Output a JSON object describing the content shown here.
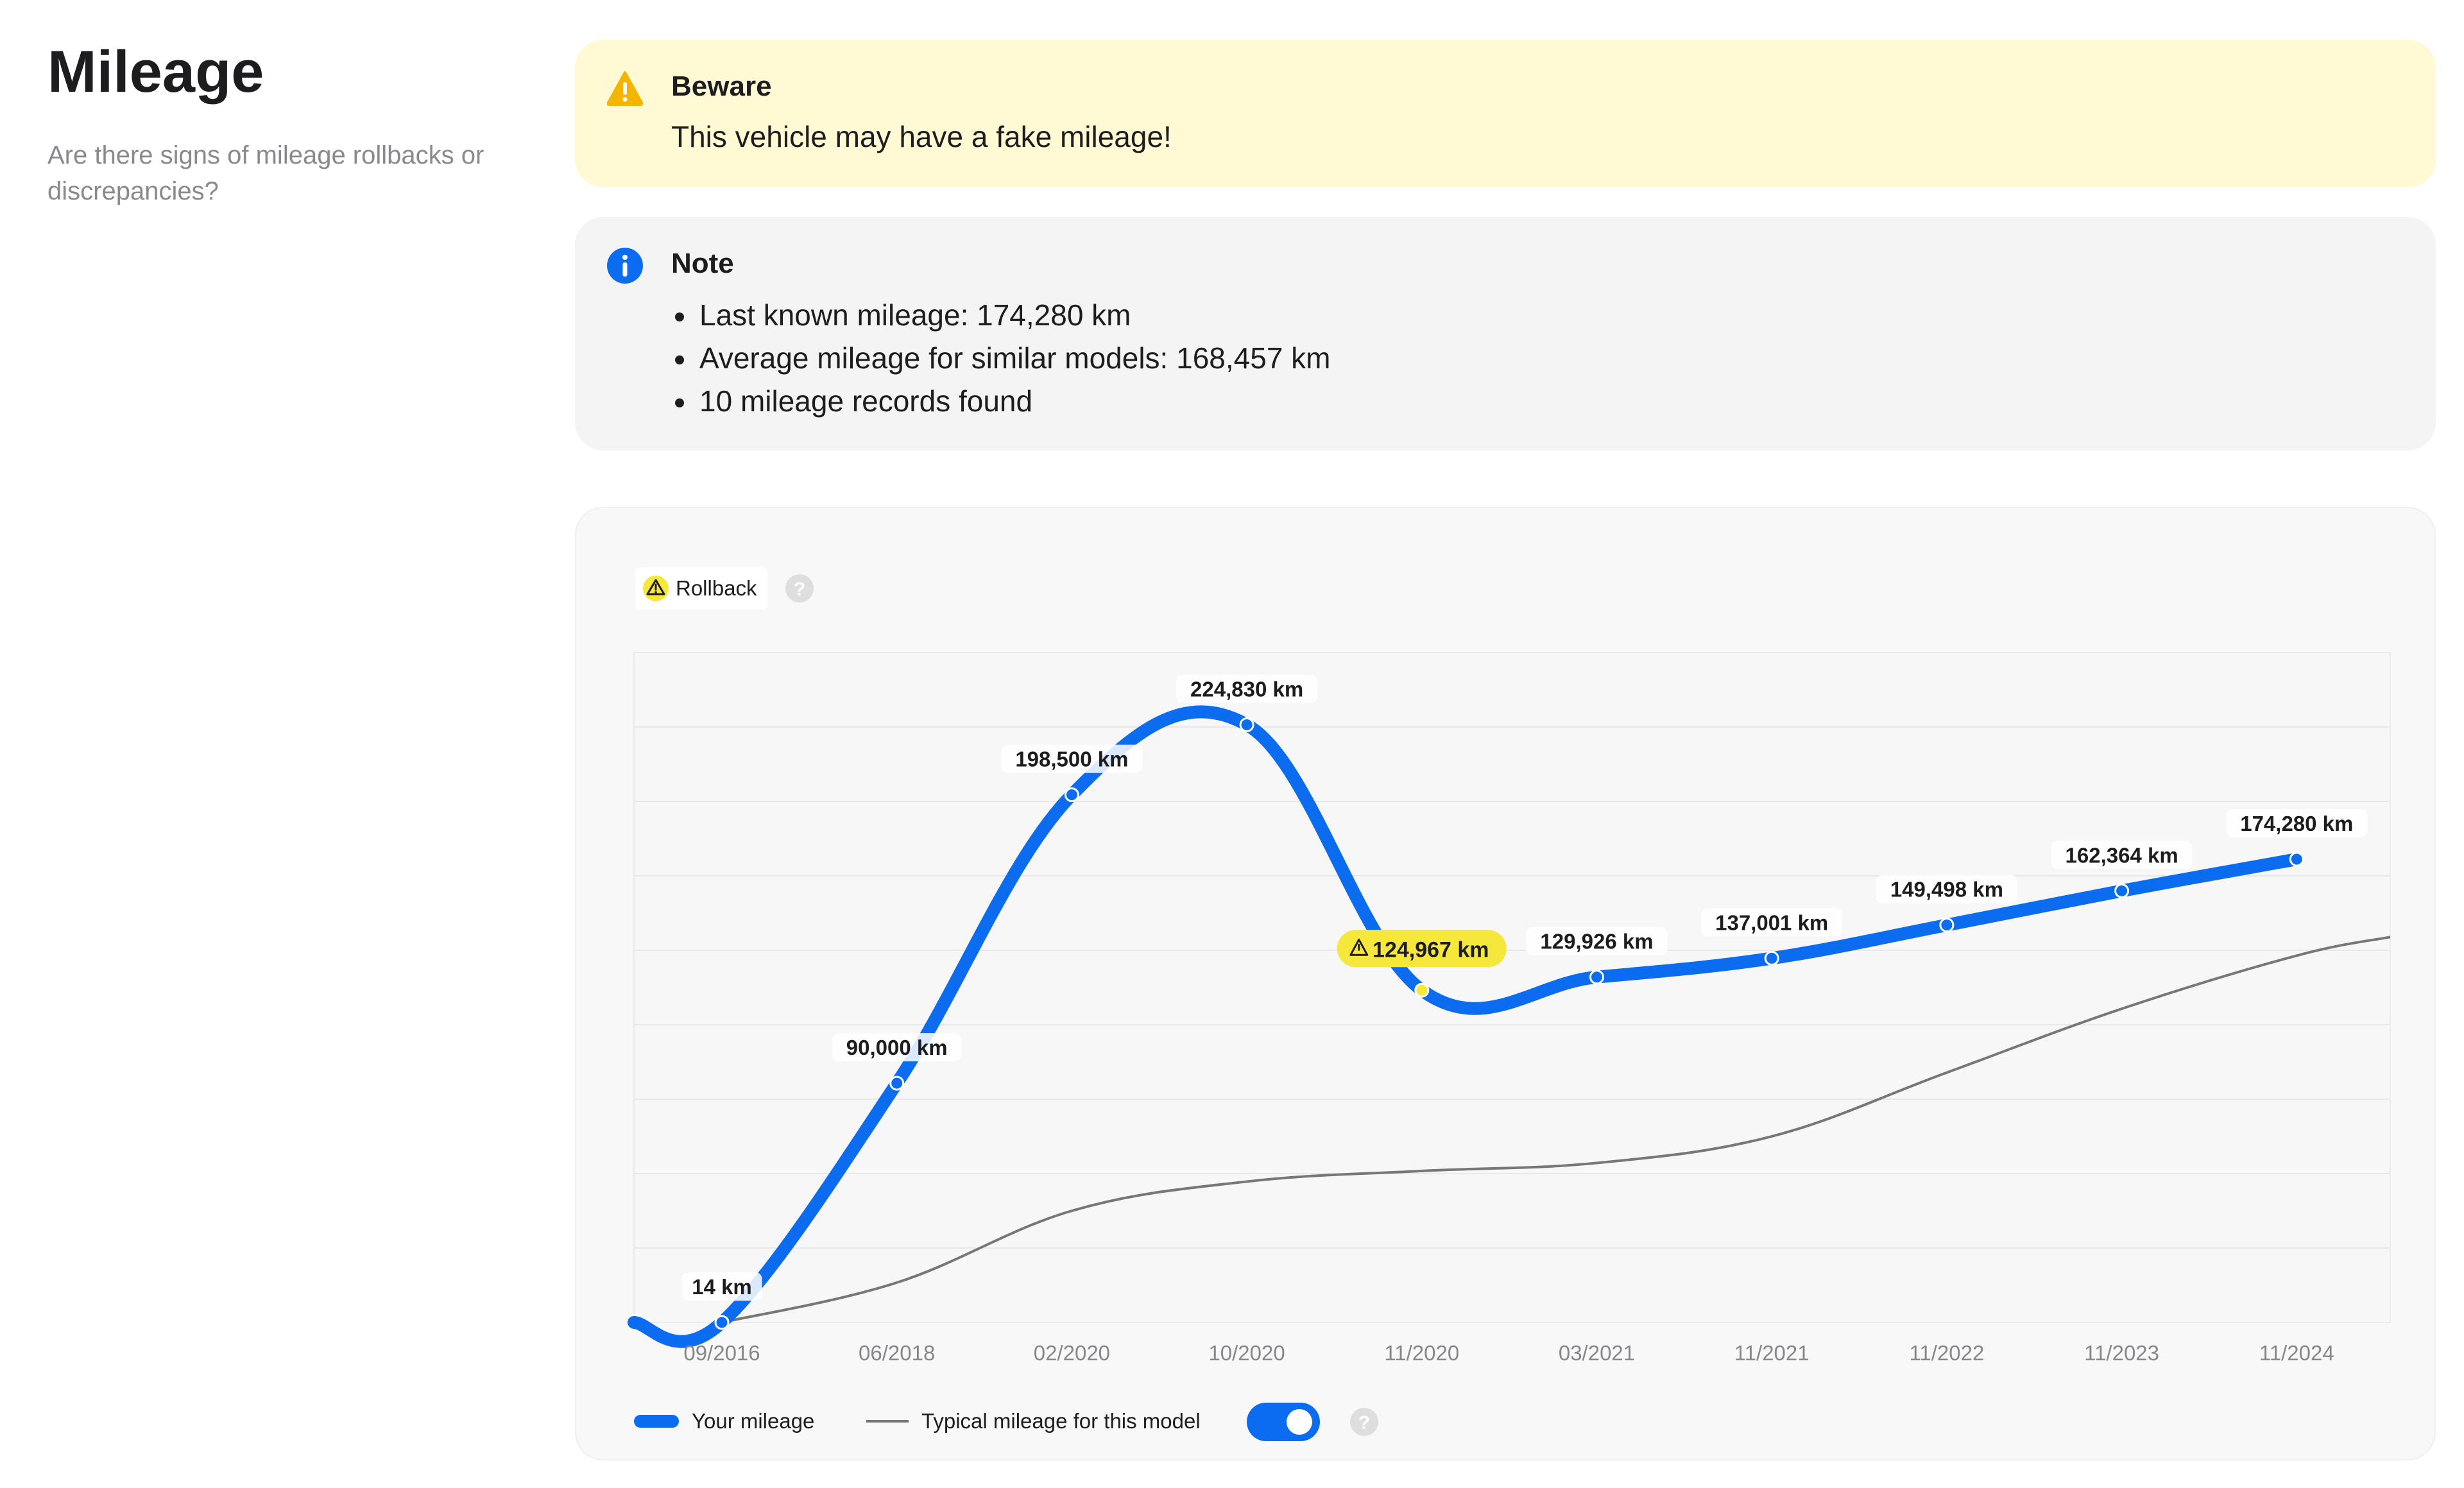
{
  "header": {
    "title": "Mileage",
    "subtitle": "Are there signs of mileage rollbacks or discrepancies?"
  },
  "warning": {
    "title": "Beware",
    "message": "This vehicle may have a fake mileage!",
    "icon": "warning-triangle-icon",
    "color": "#f5b400"
  },
  "note": {
    "title": "Note",
    "icon": "info-icon",
    "color": "#0b6cf0",
    "items": [
      "Last known mileage: 174,280 km",
      "Average mileage for similar models: 168,457 km",
      "10 mileage records found"
    ]
  },
  "chart_header": {
    "badge_label": "Rollback",
    "badge_icon": "warning-triangle-icon",
    "help_icon": "question-icon"
  },
  "chart_data": {
    "type": "line",
    "categories": [
      "09/2016",
      "06/2018",
      "02/2020",
      "10/2020",
      "11/2020",
      "03/2021",
      "11/2021",
      "11/2022",
      "11/2023",
      "11/2024"
    ],
    "series": [
      {
        "name": "Your mileage",
        "color": "#0b6cf0",
        "values": [
          14,
          90000,
          198500,
          224830,
          124967,
          129926,
          137001,
          149498,
          162364,
          174280
        ],
        "labels": [
          "14 km",
          "90,000 km",
          "198,500 km",
          "224,830 km",
          "124,967 km",
          "129,926 km",
          "137,001 km",
          "149,498 km",
          "162,364 km",
          "174,280 km"
        ],
        "flagged_index": 4
      },
      {
        "name": "Typical mileage for this model",
        "color": "#777777",
        "values": [
          0,
          15000,
          42000,
          53000,
          57000,
          60000,
          70000,
          94000,
          118000,
          138000
        ],
        "end_value": 145000
      }
    ],
    "ylim": [
      0,
      252000
    ],
    "grid": true
  },
  "legend": {
    "your_mileage": "Your mileage",
    "typical": "Typical mileage for this model",
    "toggle_on": true,
    "help_icon": "question-icon"
  }
}
